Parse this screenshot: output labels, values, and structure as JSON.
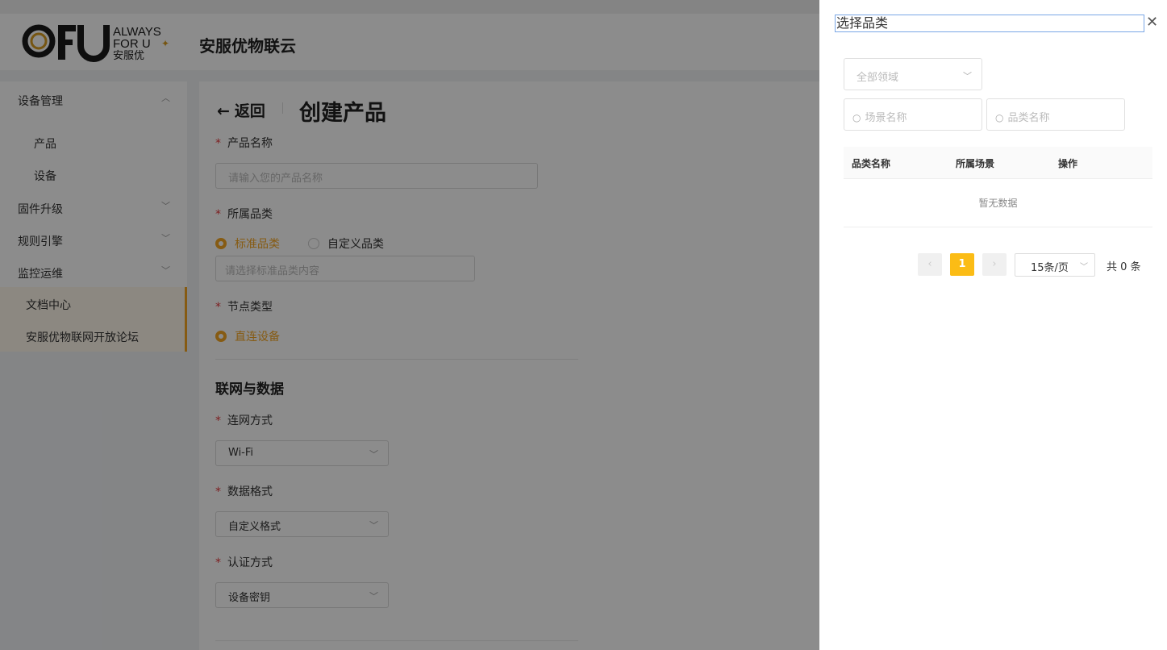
{
  "header": {
    "logo_text": "AFU ALWAYS FOR U 安服优",
    "app_title": "安服优物联云"
  },
  "sidebar": {
    "items": [
      {
        "label": "设备管理",
        "expanded": true
      },
      {
        "label": "产品"
      },
      {
        "label": "设备"
      },
      {
        "label": "固件升级",
        "expanded": false
      },
      {
        "label": "规则引擎",
        "expanded": false
      },
      {
        "label": "监控运维",
        "expanded": false
      },
      {
        "label": "文档中心",
        "active": true
      },
      {
        "label": "安服优物联网开放论坛",
        "active": true
      }
    ]
  },
  "main": {
    "back_label": "返回",
    "page_title": "创建产品",
    "product_name": {
      "label": "产品名称",
      "placeholder": "请输入您的产品名称"
    },
    "category": {
      "label": "所属品类",
      "options": [
        "标准品类",
        "自定义品类"
      ],
      "selected": "标准品类",
      "placeholder": "请选择标准品类内容"
    },
    "node_type": {
      "label": "节点类型",
      "selected": "直连设备"
    },
    "section_network": "联网与数据",
    "network": {
      "label": "连网方式",
      "value": "Wi-Fi"
    },
    "data_format": {
      "label": "数据格式",
      "value": "自定义格式"
    },
    "auth": {
      "label": "认证方式",
      "value": "设备密钥"
    }
  },
  "drawer": {
    "title": "选择品类",
    "domain_select": "全部领域",
    "scene_search_placeholder": "场景名称",
    "category_search_placeholder": "品类名称",
    "table_headers": [
      "品类名称",
      "所属场景",
      "操作"
    ],
    "empty_text": "暂无数据",
    "pagination": {
      "current_page": "1",
      "page_size": "15条/页",
      "total": "共 0 条"
    }
  },
  "colors": {
    "accent": "#f5a623",
    "page_active": "#fbbc15",
    "required": "#e4393c"
  },
  "icons": [
    "arrow-left-icon",
    "chevron-up-icon",
    "chevron-down-icon",
    "search-icon",
    "close-icon",
    "chevron-left-icon",
    "chevron-right-icon"
  ]
}
